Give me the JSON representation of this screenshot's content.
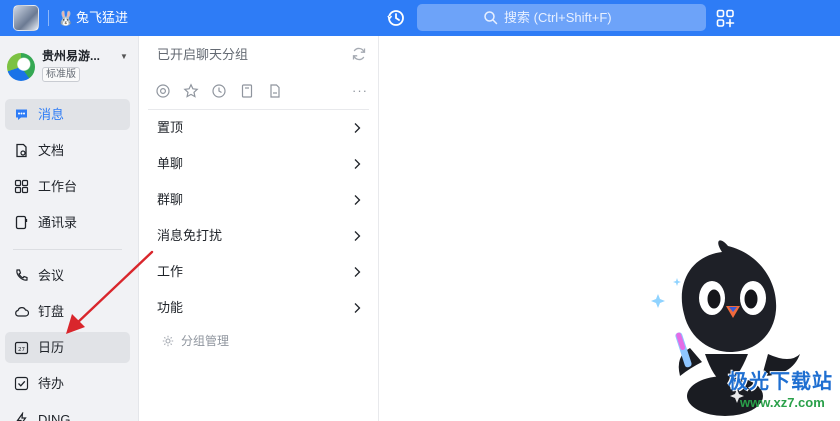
{
  "topbar": {
    "brand_name": "兔飞猛进",
    "search_placeholder": "搜索 (Ctrl+Shift+F)"
  },
  "org": {
    "name": "贵州易游...",
    "edition": "标准版"
  },
  "nav": {
    "items": [
      {
        "label": "消息",
        "icon": "message-icon",
        "active": true
      },
      {
        "label": "文档",
        "icon": "document-icon"
      },
      {
        "label": "工作台",
        "icon": "workbench-icon"
      },
      {
        "label": "通讯录",
        "icon": "contacts-icon"
      },
      {
        "label": "会议",
        "icon": "meeting-phone-icon"
      },
      {
        "label": "钉盘",
        "icon": "cloud-drive-icon"
      },
      {
        "label": "日历",
        "icon": "calendar-icon"
      },
      {
        "label": "待办",
        "icon": "todo-check-icon"
      },
      {
        "label": "DING",
        "icon": "lightning-icon"
      }
    ]
  },
  "chat_panel": {
    "title": "已开启聊天分组",
    "filters": [
      "at-mention-icon",
      "star-icon",
      "clock-icon",
      "bookmark-icon",
      "file-icon"
    ],
    "groups": [
      {
        "label": "置顶"
      },
      {
        "label": "单聊"
      },
      {
        "label": "群聊"
      },
      {
        "label": "消息免打扰"
      },
      {
        "label": "工作"
      },
      {
        "label": "功能"
      }
    ],
    "manage_label": "分组管理"
  },
  "watermark": {
    "name": "极光下载站",
    "url": "www.xz7.com"
  },
  "colors": {
    "accent": "#2e7cf6",
    "sidebar_bg": "#f1f2f5",
    "annotation_arrow": "#d9262c"
  }
}
